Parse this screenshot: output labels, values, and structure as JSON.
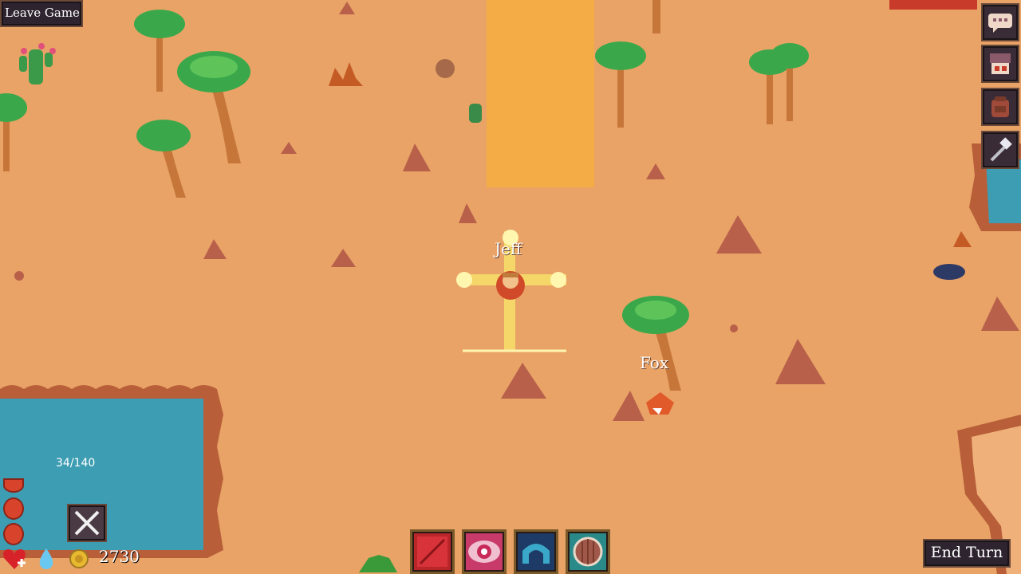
{
  "header": {
    "leave_label": "Leave Game"
  },
  "footer": {
    "end_turn_label": "End Turn"
  },
  "player": {
    "name": "Jeff",
    "hp": "34/140",
    "gold": "2730"
  },
  "enemy": {
    "name": "Fox"
  },
  "side_menu": [
    "chat-icon",
    "shop-icon",
    "backpack-icon",
    "hammer-icon"
  ],
  "abilities": [
    "red-rune-icon",
    "eye-icon",
    "arch-icon",
    "shield-icon"
  ],
  "colors": {
    "sand": "#e9a366",
    "water": "#3d9db3",
    "shore": "#b85f3a",
    "ui_dark": "#2e2430",
    "highlight": "#f7d44a"
  }
}
